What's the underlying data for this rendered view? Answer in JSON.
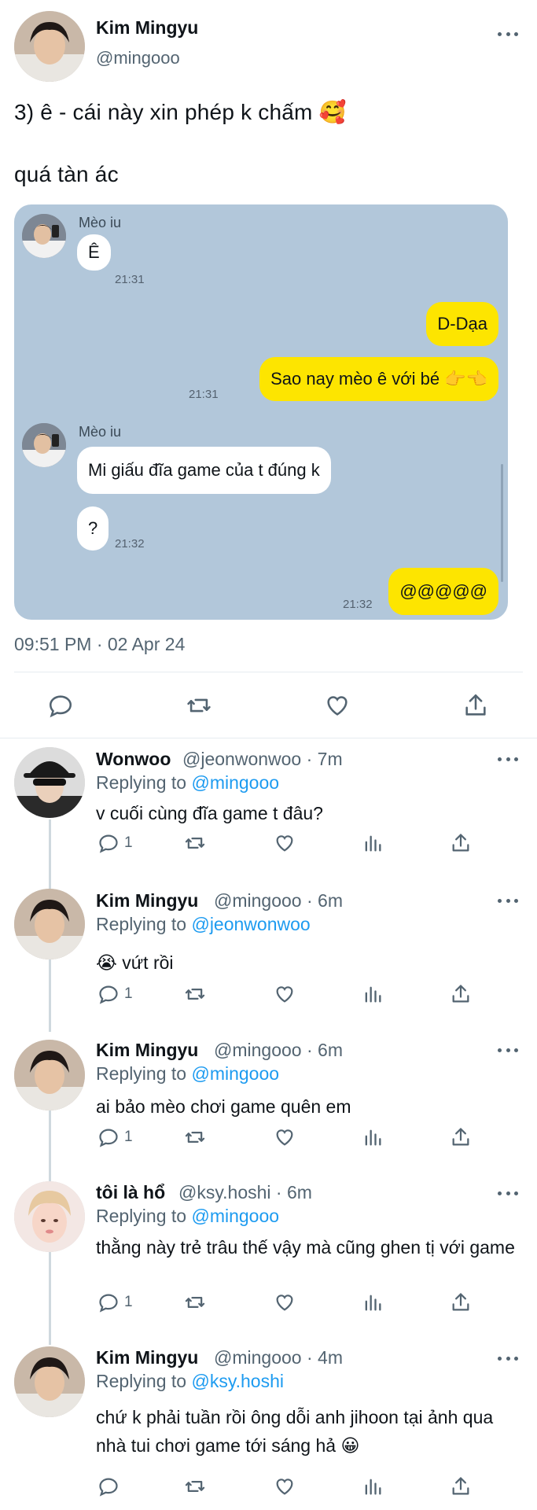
{
  "main_tweet": {
    "author_name": "Kim Mingyu",
    "author_handle": "@mingooo",
    "text_line1": "3) ê - cái này xin phép k chấm 🥰",
    "text_line2": "quá tàn ác",
    "timestamp": "09:51 PM · 02 Apr 24"
  },
  "chat": {
    "sender_name_1": "Mèo iu",
    "msg_1": "Ê",
    "time_1": "21:31",
    "msg_2": "D-Dạa",
    "msg_3": "Sao nay mèo ê với bé 👉👈",
    "time_3": "21:31",
    "sender_name_2": "Mèo iu",
    "msg_4": "Mi giấu đĩa game của t đúng k",
    "msg_5": "?",
    "time_5": "21:32",
    "msg_6": "@@@@@",
    "time_6": "21:32"
  },
  "replies": [
    {
      "name": "Wonwoo",
      "handle": "@jeonwonwoo",
      "time": "7m",
      "replying_label": "Replying to",
      "replying_to": "@mingooo",
      "text": "v cuối cùng đĩa game t đâu?",
      "reply_count": "1"
    },
    {
      "name": "Kim Mingyu",
      "handle": "@mingooo",
      "time": "6m",
      "replying_label": "Replying to",
      "replying_to": "@jeonwonwoo",
      "text": "😭  vứt rồi",
      "reply_count": "1"
    },
    {
      "name": "Kim Mingyu",
      "handle": "@mingooo",
      "time": "6m",
      "replying_label": "Replying to",
      "replying_to": "@mingooo",
      "text": "ai bảo mèo chơi game quên em",
      "reply_count": "1"
    },
    {
      "name": "tôi là hổ",
      "handle": "@ksy.hoshi",
      "time": "6m",
      "replying_label": "Replying to",
      "replying_to": "@mingooo",
      "text": "thằng này trẻ trâu thế vậy mà cũng ghen tị với game",
      "reply_count": "1"
    },
    {
      "name": "Kim Mingyu",
      "handle": "@mingooo",
      "time": "4m",
      "replying_label": "Replying to",
      "replying_to": "@ksy.hoshi",
      "text": "chứ k phải tuần rồi ông dỗi anh jihoon tại ảnh qua nhà tui chơi game tới sáng hả 😀",
      "reply_count": ""
    }
  ],
  "colors": {
    "accent": "#1d9bf0",
    "chat_bg": "#b2c7da",
    "bubble_out": "#fde500",
    "muted": "#536471"
  },
  "icons": [
    "more-icon",
    "reply-icon",
    "retweet-icon",
    "like-icon",
    "share-icon",
    "views-icon"
  ]
}
